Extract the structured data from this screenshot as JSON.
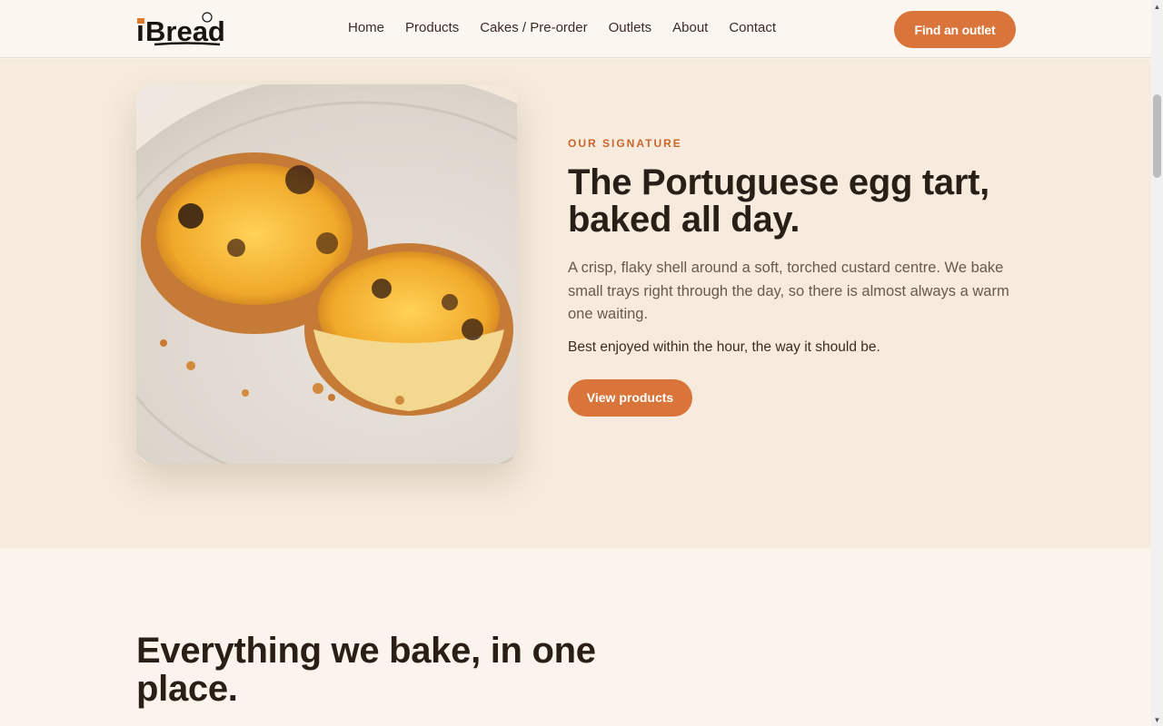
{
  "header": {
    "logo_text": "iBread",
    "nav": [
      "Home",
      "Products",
      "Cakes / Pre-order",
      "Outlets",
      "About",
      "Contact"
    ],
    "cta_label": "Find an outlet"
  },
  "hero": {
    "image_alt": "Portuguese egg tarts on a plate",
    "eyebrow": "OUR SIGNATURE",
    "title": "The Portuguese egg tart, baked all day.",
    "description": "A crisp, flaky shell around a soft, torched custard centre. We bake small trays right through the day, so there is almost always a warm one waiting.",
    "note": "Best enjoyed within the hour, the way it should be.",
    "button_label": "View products"
  },
  "section2": {
    "title": "Everything we bake, in one place."
  },
  "colors": {
    "accent": "#d9743a",
    "hero_bg": "#f6ebdd",
    "page_bg": "#faf4ec"
  }
}
